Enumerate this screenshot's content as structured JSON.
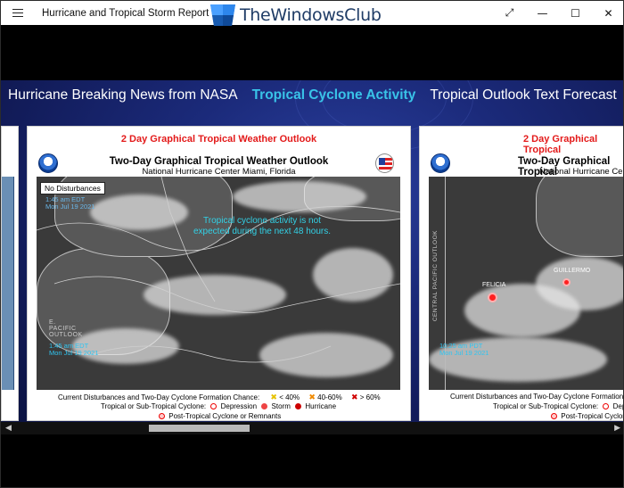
{
  "app": {
    "title": "Hurricane and Tropical Storm Report",
    "watermark": "TheWindowsClub"
  },
  "window_controls": {
    "restore": "⤢",
    "minimize": "—",
    "maximize": "☐",
    "close": "✕"
  },
  "tabs": [
    {
      "label": "Hurricane Breaking News from NASA",
      "active": false
    },
    {
      "label": "Tropical Cyclone Activity",
      "active": true
    },
    {
      "label": "Tropical Outlook Text Forecast",
      "active": false
    }
  ],
  "panels": {
    "main": {
      "header": "2 Day Graphical Tropical Weather Outlook",
      "title": "Two-Day Graphical Tropical Weather Outlook",
      "subtitle": "National Hurricane Center  Miami, Florida",
      "status_box": "No Disturbances",
      "message": "Tropical cyclone activity is not expected during the next 48 hours.",
      "time_stamp_line1": "1:45 am EDT",
      "time_stamp_line2": "Mon Jul 19 2021",
      "region_label": "E. PACIFIC OUTLOOK",
      "legend": {
        "row1_label": "Current Disturbances and Two-Day Cyclone Formation Chance:",
        "chance_low": "< 40%",
        "chance_mid": "40-60%",
        "chance_high": "> 60%",
        "row2_label": "Tropical or Sub-Tropical Cyclone:",
        "depression": "Depression",
        "storm": "Storm",
        "hurricane": "Hurricane",
        "post_tropical": "Post-Tropical Cyclone or Remnants"
      }
    },
    "right": {
      "header": "2 Day Graphical Tropical",
      "title": "Two-Day Graphical Tropical",
      "subtitle": "National Hurricane Cent",
      "region_label": "CENTRAL PACIFIC OUTLOOK",
      "storm1": "FELICIA",
      "storm2": "GUILLERMO",
      "time_stamp_line1": "10:25 am PDT",
      "time_stamp_line2": "Mon Jul 19 2021",
      "legend_row1": "Current Disturbances and Two-Day Cyclone Formation",
      "legend_row2_label": "Tropical or Sub-Tropical Cyclone:",
      "legend_row2_item": "Depr",
      "legend_row3": "Post-Tropical Cyclon"
    }
  },
  "colors": {
    "active_tab": "#39c3e8",
    "panel_header": "#e31a1a",
    "satellite_text": "#32d1e6"
  },
  "scrollbar": {
    "left_arrow": "◀",
    "right_arrow": "▶"
  }
}
